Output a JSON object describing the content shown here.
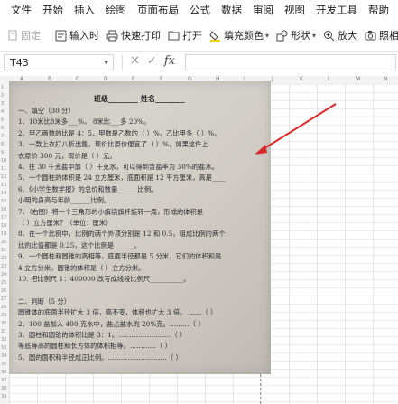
{
  "menu": [
    "文件",
    "开始",
    "插入",
    "绘图",
    "页面布局",
    "公式",
    "数据",
    "审阅",
    "视图",
    "开发工具",
    "帮助"
  ],
  "toolbar": {
    "pin": "固定",
    "pin_icon": "pin-icon",
    "insert_time": "输入时",
    "quick_print": "快速打印",
    "open": "打开",
    "fill_color": "填充颜色",
    "shape": "形状",
    "zoom_in": "放大",
    "snapshot": "照相"
  },
  "formula_bar": {
    "cell_ref": "T43",
    "cancel": "✕",
    "confirm": "✓",
    "fx": "fx",
    "value": ""
  },
  "grid": {
    "columns": [
      "A",
      "B",
      "C",
      "D",
      "E",
      "F",
      "G",
      "H",
      "I",
      "J",
      "K",
      "L",
      "M",
      "N"
    ],
    "rows": [
      "1",
      "2",
      "3",
      "4",
      "5",
      "6",
      "7",
      "8",
      "9",
      "10",
      "11",
      "12",
      "13",
      "14",
      "15",
      "16",
      "17",
      "18",
      "19",
      "20",
      "21",
      "22",
      "23",
      "24",
      "25",
      "26",
      "27",
      "28",
      "29",
      "30",
      "31",
      "32",
      "33",
      "34",
      "35",
      "36",
      "37",
      "38",
      "39"
    ]
  },
  "photo": {
    "title": "班级________ 姓名________",
    "lines": [
      "一、填空（30 分）",
      "1、10米比8米多___%，   8米比___多 20%。",
      "2、甲乙两数的比是 4：5，甲数是乙数的（ ）%，乙比甲多（ ）%。",
      "  3、一款上衣打八折出售，现价比原价便宜了（ ）%，如果这件上",
      "衣原价 300 元，现价是（ ）元。",
      "  4、往 30 千克盐中加（ ）千克水，可以得到含盐率为 30%的盐水。",
      "  5、一个圆柱的体积是 24 立方厘米，底面积是 12 平方厘米，高是____",
      "  6、《小学生数学报》的总价和数量______比例。",
      "  小明的身高与年龄______比例。",
      "  7、（右图）将一个三角形的小旗绕旗杆旋转一周，形成的体积是",
      "（ ）立方厘米？（单位：厘米）",
      "  8、在一个比例中，比例的两个外项分别是 12 和 0.5，组成比例的两个",
      "比的比值都是 0.25，这个比例是______。",
      "  9、一个圆柱和圆锥的高相等，底面半径都是 5 分米，它们的体积和是",
      "4 立方分米，圆锥的体积是（ ）立方分米。",
      "10. 把比例尺 1：400000 改写成线段比例尺__________。",
      "",
      "二、判断（5 分）",
      "  圆锥体的底面半径扩大 3 倍，高不变，体积也扩大 3 倍。 ……（ ）",
      "2、100 盐加入 400 克水中，盐占盐水的 20%克。………（ ）",
      "3、圆柱和圆锥的体积比是 3：1。……………………（ ）",
      "  等底等高的圆柱和长方体的体积相等。…………（ ）",
      "5、圆的面积和半径成正比例。………………………（ ）"
    ]
  },
  "colors": {
    "arrow": "#d62b2b",
    "accent": "#1a73e8"
  }
}
